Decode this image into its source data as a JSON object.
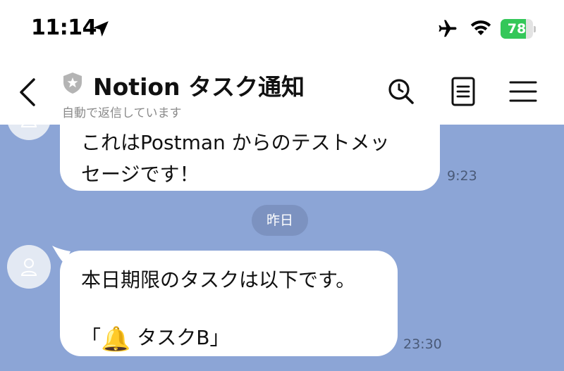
{
  "status_bar": {
    "time": "11:14",
    "battery_level": 78,
    "battery_text": "78",
    "icons": [
      "location-arrow-icon",
      "airplane-icon",
      "wifi-icon",
      "battery-icon"
    ]
  },
  "header": {
    "title": "Notion タスク通知",
    "subtitle": "自動で返信しています",
    "buttons": [
      "back-icon",
      "search-icon",
      "notes-icon",
      "menu-icon"
    ]
  },
  "messages": [
    {
      "lines": [
        "これはPostman からのテストメッ",
        "セージです！"
      ],
      "time": "9:23"
    },
    {
      "lines": [
        "本日期限のタスクは以下です。",
        "",
        "「",
        "タスクB」"
      ],
      "emoji": "🔔",
      "time": "23:30"
    }
  ],
  "date_separator": "昨日",
  "colors": {
    "chat_background": "#8ca5d6",
    "bubble": "#ffffff",
    "date_separator": "#7c92c0",
    "battery_fill": "#34c759"
  }
}
